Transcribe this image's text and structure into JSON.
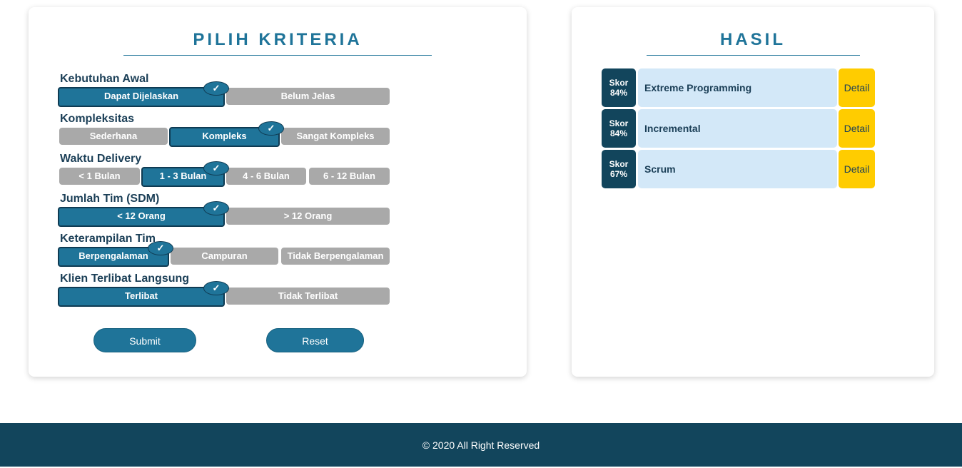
{
  "criteria": {
    "title": "PILIH KRITERIA",
    "groups": [
      {
        "label": "Kebutuhan Awal",
        "options": [
          "Dapat Dijelaskan",
          "Belum Jelas"
        ],
        "selected": 0
      },
      {
        "label": "Kompleksitas",
        "options": [
          "Sederhana",
          "Kompleks",
          "Sangat Kompleks"
        ],
        "selected": 1
      },
      {
        "label": "Waktu Delivery",
        "options": [
          "< 1 Bulan",
          "1 - 3 Bulan",
          "4 - 6 Bulan",
          "6 - 12 Bulan"
        ],
        "selected": 1
      },
      {
        "label": "Jumlah Tim (SDM)",
        "options": [
          "< 12 Orang",
          "> 12 Orang"
        ],
        "selected": 0
      },
      {
        "label": "Keterampilan Tim",
        "options": [
          "Berpengalaman",
          "Campuran",
          "Tidak Berpengalaman"
        ],
        "selected": 0
      },
      {
        "label": "Klien Terlibat Langsung",
        "options": [
          "Terlibat",
          "Tidak Terlibat"
        ],
        "selected": 0
      }
    ],
    "check_glyph": "✓",
    "submit_label": "Submit",
    "reset_label": "Reset"
  },
  "results": {
    "title": "HASIL",
    "score_label": "Skor",
    "detail_label": "Detail",
    "items": [
      {
        "score": "84%",
        "name": "Extreme Programming"
      },
      {
        "score": "84%",
        "name": "Incremental"
      },
      {
        "score": "67%",
        "name": "Scrum"
      }
    ]
  },
  "footer": {
    "text": "© 2020 All Right Reserved"
  },
  "colors": {
    "primary": "#1f7499",
    "dark": "#12455c",
    "unselected": "#a9a9a9",
    "detail": "#ffcc00",
    "result_bg": "#d3e8f8"
  }
}
